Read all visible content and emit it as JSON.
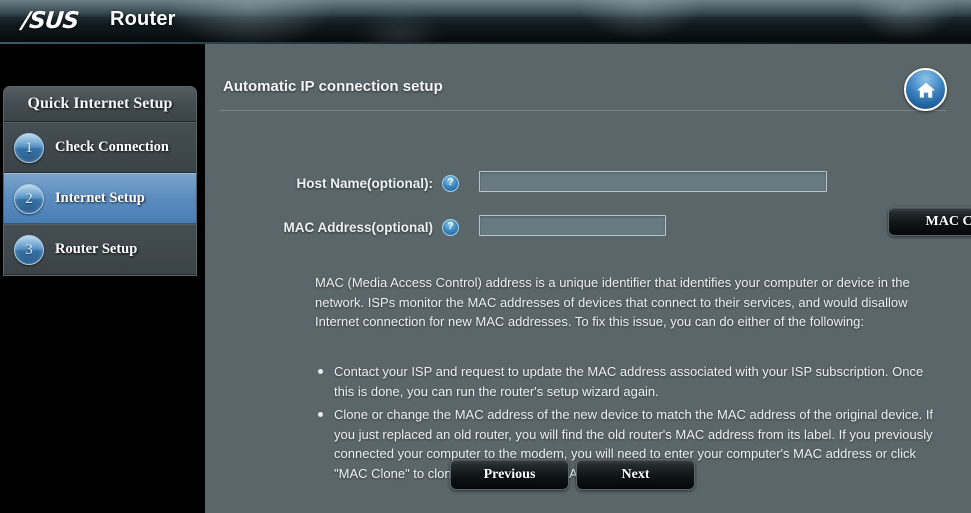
{
  "header": {
    "brand": "/SUS",
    "title": "Router"
  },
  "sidebar": {
    "panel_title": "Quick Internet Setup",
    "items": [
      {
        "number": "1",
        "label": "Check Connection",
        "active": false
      },
      {
        "number": "2",
        "label": "Internet Setup",
        "active": true
      },
      {
        "number": "3",
        "label": "Router Setup",
        "active": false
      }
    ]
  },
  "content": {
    "title": "Automatic IP connection setup",
    "home_icon": "home-icon",
    "fields": [
      {
        "label": "Host Name(optional):",
        "help_icon": "?",
        "value": "",
        "placeholder": ""
      },
      {
        "label": "MAC Address(optional)",
        "help_icon": "?",
        "value": "",
        "placeholder": ""
      }
    ],
    "mac_clone_label": "MAC Clone",
    "description": "MAC (Media Access Control) address is a unique identifier that identifies your computer or device in the network. ISPs monitor the MAC addresses of devices that connect to their services, and would disallow Internet connection for new MAC addresses. To fix this issue, you can do either of the following:",
    "bullets": [
      "Contact your ISP and request to update the MAC address associated with your ISP subscription. Once this is done, you can run the router's setup wizard again.",
      "Clone or change the MAC address of the new device to match the MAC address of the original device. If you just replaced an old router, you will find the old router's MAC address from its label. If you previously connected your computer to the modem, you will need to enter your computer's MAC address or click \"MAC Clone\" to clone your computer's MAC addresss."
    ],
    "previous_label": "Previous",
    "next_label": "Next"
  },
  "colors": {
    "panel_bg": "#5b666a",
    "accent_blue": "#5d8ec0",
    "badge_blue": "#3d7fb8",
    "sidebar_bg": "#000000",
    "input_bg": "#697a80"
  }
}
